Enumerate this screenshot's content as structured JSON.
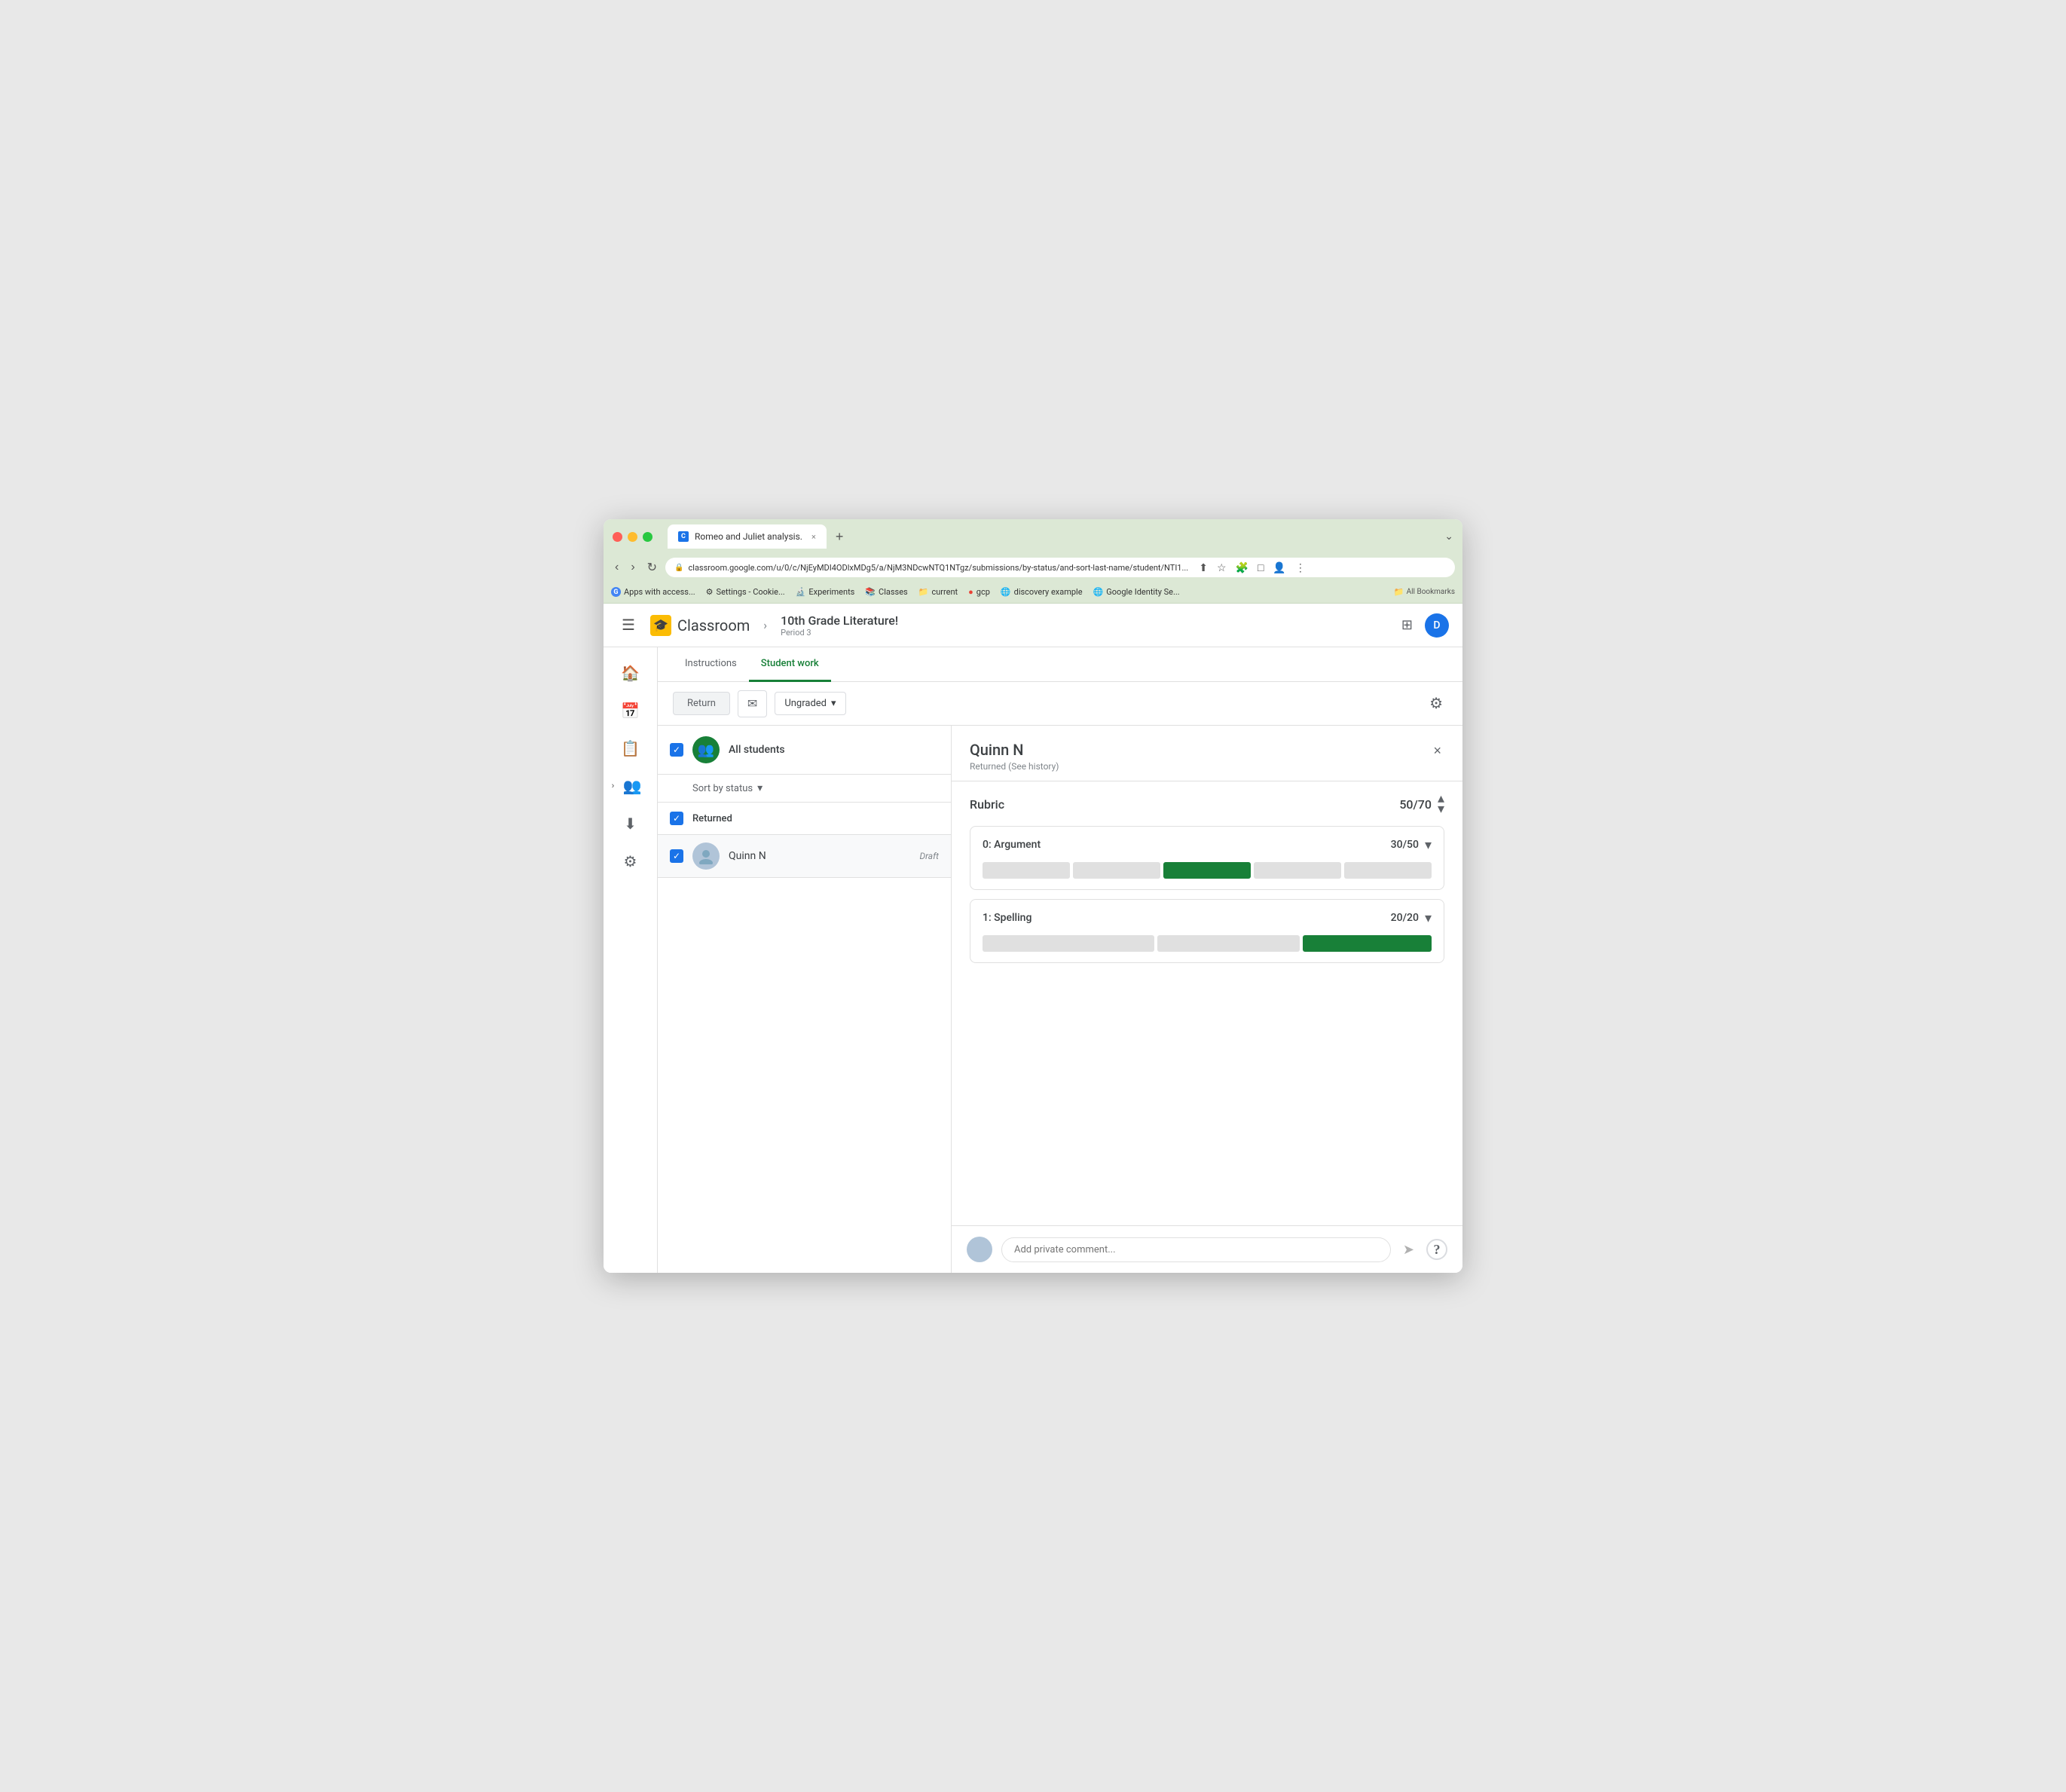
{
  "browser": {
    "tab_title": "Romeo and Juliet analysis.",
    "url": "classroom.google.com/u/0/c/NjEyMDI4ODlxMDg5/a/NjM3NDcwNTQ1NTgz/submissions/by-status/and-sort-last-name/student/NTI1...",
    "new_tab_label": "+",
    "chevron": "⌄",
    "bookmarks": [
      {
        "label": "Apps with access...",
        "icon": "G"
      },
      {
        "label": "Settings - Cookie..."
      },
      {
        "label": "Experiments"
      },
      {
        "label": "Classes"
      },
      {
        "label": "current"
      },
      {
        "label": "gcp"
      },
      {
        "label": "discovery example"
      },
      {
        "label": "Google Identity Se..."
      },
      {
        "label": "All Bookmarks"
      }
    ]
  },
  "header": {
    "menu_icon": "☰",
    "classroom_logo": "🎓",
    "app_name": "Classroom",
    "breadcrumb_arrow": "›",
    "course_name": "10th Grade Literature!",
    "course_period": "Period 3",
    "grid_icon": "⋮⋮⋮",
    "avatar_letter": "D"
  },
  "tabs": {
    "instructions_label": "Instructions",
    "student_work_label": "Student work"
  },
  "toolbar": {
    "return_label": "Return",
    "email_icon": "✉",
    "grade_label": "Ungraded",
    "settings_icon": "⚙"
  },
  "student_list": {
    "all_students_label": "All students",
    "sort_label": "Sort by status",
    "returned_label": "Returned",
    "students": [
      {
        "name": "Quinn N",
        "status": "Draft"
      }
    ]
  },
  "detail": {
    "student_name": "Quinn N",
    "student_status": "Returned (See history)",
    "rubric_title": "Rubric",
    "rubric_score": "50",
    "rubric_total": "70",
    "criteria": [
      {
        "name": "0: Argument",
        "score": "30",
        "total": "50",
        "segments": 5,
        "selected_index": 2
      },
      {
        "name": "1: Spelling",
        "score": "20",
        "total": "20",
        "segments": 3,
        "selected_index": 2
      }
    ]
  },
  "comment": {
    "placeholder": "Add private comment...",
    "send_icon": "➤",
    "help_icon": "?"
  },
  "icons": {
    "close": "×",
    "check": "✓",
    "chevron_down": "▾",
    "chevron_up": "▴",
    "home": "⌂",
    "calendar": "📅",
    "assignment": "📋",
    "people": "👥",
    "download": "⬇",
    "settings": "⚙",
    "expand_people": "›"
  }
}
